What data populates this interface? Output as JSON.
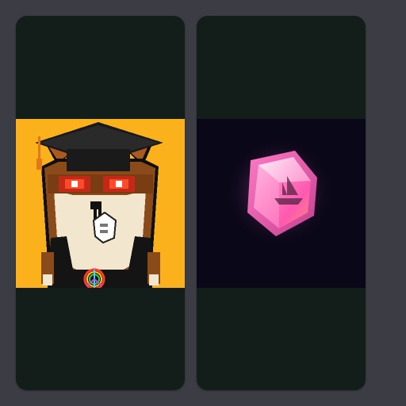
{
  "cards": [
    {
      "image": "pixel-shiba-graduate",
      "background": "#fbb11c",
      "top_panel_color": "#131d1a",
      "bottom_panel_color": "#131d1a"
    },
    {
      "image": "pink-crystal-gem",
      "background": "#0a0718",
      "top_panel_color": "#131d1a",
      "bottom_panel_color": "#131d1a"
    }
  ],
  "colors": {
    "page_background": "#3c3d44",
    "card_background": "#131d1a"
  }
}
